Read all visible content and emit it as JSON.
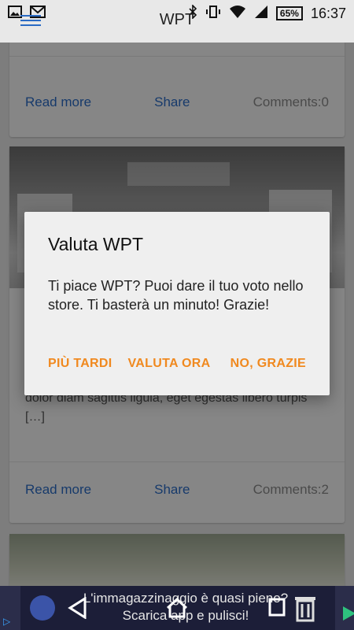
{
  "status_bar": {
    "battery_percent": "65%",
    "time": "16:37"
  },
  "app_bar": {
    "title": "WPT",
    "menu_icon": "hamburger-menu-icon"
  },
  "cards": [
    {
      "read_more": "Read more",
      "share": "Share",
      "comments": "Comments:0"
    },
    {
      "excerpt": "dolor diam sagittis ligula, eget egestas libero turpis […]",
      "read_more": "Read more",
      "share": "Share",
      "comments": "Comments:2"
    }
  ],
  "dialog": {
    "title": "Valuta WPT",
    "message": "Ti piace WPT? Puoi dare il tuo voto nello store. Ti basterà un minuto! Grazie!",
    "buttons": {
      "later": "PIÙ TARDI",
      "rate_now": "VALUTA ORA",
      "no_thanks": "NO, GRAZIE"
    }
  },
  "ad": {
    "line1": "L'immagazzinaggio è quasi pieno?",
    "line2": "Scarica app e pulisci!"
  },
  "colors": {
    "accent": "#f0891f",
    "link": "#2a6bc4"
  }
}
